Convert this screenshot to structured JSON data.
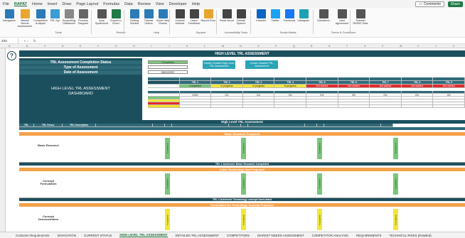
{
  "menu": [
    "File",
    "RAPAT",
    "Home",
    "Insert",
    "Draw",
    "Page Layout",
    "Formulas",
    "Data",
    "Review",
    "View",
    "Developer",
    "Help"
  ],
  "menu_active": "RAPAT",
  "top_buttons": {
    "comments": "Comments",
    "share": "Share"
  },
  "ribbon": {
    "buttons": [
      {
        "label": "Navigation",
        "icon": "navigation-icon",
        "color": "#2b7bb9"
      },
      {
        "label": "Market Needs Assessment",
        "icon": "grid-icon",
        "color": "#e8a530"
      },
      {
        "label": "Competitive Analysis",
        "icon": "people-icon",
        "color": "#2b7bb9"
      },
      {
        "label": "TRL Spi",
        "icon": "chart-icon",
        "color": "#3a9bd5"
      },
      {
        "label": "Supporting Datasheet",
        "icon": "datasheet-icon",
        "color": "#888888"
      },
      {
        "label": "Process Diagram",
        "icon": "diagram-icon",
        "color": "#666666"
      },
      {
        "label": "Auto Spellcheck",
        "icon": "spellcheck-icon",
        "color": "#555555"
      },
      {
        "label": "Export to Excel",
        "icon": "export-icon",
        "color": "#1f7a45"
      },
      {
        "label": "Getting Started",
        "icon": "info-icon",
        "color": "#2b7bb9"
      },
      {
        "label": "Tutorial Videos",
        "icon": "video-icon",
        "color": "#2b7bb9"
      },
      {
        "label": "Excel Help Sheets",
        "icon": "help-icon",
        "color": "#2b7bb9"
      },
      {
        "label": "Contact Antimar",
        "icon": "contact-icon",
        "color": "#444444"
      },
      {
        "label": "Leave Feedback",
        "icon": "feedback-icon",
        "color": "#444444"
      },
      {
        "label": "Report Error",
        "icon": "warning-icon",
        "color": "#e8a530"
      },
      {
        "label": "Read Aloud",
        "icon": "read-aloud-icon",
        "color": "#444444"
      },
      {
        "label": "Dictate Speech",
        "icon": "dictate-icon",
        "color": "#444444"
      },
      {
        "label": "LinkedIn",
        "icon": "linkedin-icon",
        "color": "#0a66c2"
      },
      {
        "label": "Twitter",
        "icon": "twitter-icon",
        "color": "#1da1f2"
      },
      {
        "label": "Facebook",
        "icon": "facebook-icon",
        "color": "#1877f2"
      },
      {
        "label": "Instagram",
        "icon": "instagram-icon",
        "color": "#1ea0b5"
      },
      {
        "label": "Disclaimer",
        "icon": "disclaimer-icon",
        "color": "#555555"
      },
      {
        "label": "User Agreement",
        "icon": "agreement-icon",
        "color": "#555555"
      },
      {
        "label": "Transfer RAPAT Data",
        "icon": "transfer-icon",
        "color": "#555555"
      }
    ],
    "groups": [
      {
        "label": "Tools"
      },
      {
        "label": "Review"
      },
      {
        "label": "Help"
      },
      {
        "label": "Support"
      },
      {
        "label": "Accessibility Tools"
      },
      {
        "label": "Social Media"
      },
      {
        "label": "Terms & Conditions"
      }
    ]
  },
  "formula_bar": {
    "namebox": "Z33",
    "fx": "fx"
  },
  "columns": [
    "A",
    "B",
    "C",
    "D",
    "E",
    "F",
    "G",
    "H",
    "I",
    "J",
    "K",
    "L",
    "M",
    "N",
    "O",
    "P",
    "Q",
    "R",
    "S",
    "T",
    "U",
    "V",
    "W",
    "X",
    "Y",
    "Z"
  ],
  "dashboard": {
    "banner": "HIGH LEVEL TRL ASSESSMENT",
    "rows": [
      "TRL Assessment Completion Status",
      "Type of Assessment",
      "Date of Assessment"
    ],
    "values": [
      "Completed",
      "",
      "08/01/2022"
    ],
    "title_line1": "HIGH LEVEL TRL ASSESSMENT",
    "title_line2": "DASHBOARD",
    "btn1": "Create Detailed High Level TRL Assessment",
    "btn2": "Create Detailed TRL Assessment"
  },
  "summary": {
    "header1": [
      "",
      "",
      "",
      "",
      "",
      "",
      "",
      "",
      "",
      ""
    ],
    "header2": [
      "TRL 1",
      "TRL 2",
      "TRL 3",
      "TRL 4",
      "TRL 5",
      "TRL 6",
      "TRL 7",
      "TRL 8",
      "TRL 9"
    ],
    "status_row": [
      "Completed",
      "In progress",
      "In progress",
      "In progress",
      "Not started",
      "Not started",
      "Not started",
      "Not started",
      "Not started"
    ],
    "pct_row": [
      "100%",
      "0%",
      "0%",
      "0%",
      "0%",
      "0%",
      "0%",
      "0%",
      "0%"
    ],
    "legend": [
      "",
      "",
      "",
      ""
    ]
  },
  "main_table": {
    "title": "High Level TRL Assessment",
    "headers": [
      "TRL",
      "TRL Focus",
      "TRL Description",
      "",
      "",
      "",
      "",
      "",
      "",
      "",
      "",
      "",
      "",
      ""
    ],
    "sub_header": "",
    "sections": [
      {
        "bar": "Basic Research Proposed",
        "trl": "1",
        "name": "Basic Research",
        "desc": "",
        "stat": "Completed"
      },
      {
        "bar": "Initial Technology Idea Proposed",
        "trl": "2",
        "name": "Concept Formulation",
        "desc": "",
        "stat": "Completed"
      },
      {
        "bar": "Formulated the Technology Concept Proposed",
        "trl": "3",
        "name": "Concept Demonstration",
        "desc": "",
        "stat": "In progress"
      }
    ],
    "separators": [
      "TRL 1 Achieved: Basic Research Completed",
      "TRL 2 Achieved: Technology concept formulated"
    ]
  },
  "sheet_tabs": [
    "Customer Requirements",
    "NAVIGATION",
    "CURRENT STATUS",
    "HIGH LEVEL TRL ASSESSMENT",
    "DETAILED TRL ASSESSMENT",
    "COMPETITORS",
    "MARKET NEEDS ASSESSMENT",
    "COMPETITOR ANALYSIS",
    "REQUIREMENTS",
    "TECHNICAL RISKS (Detailed)"
  ],
  "sheet_tab_active": "HIGH LEVEL TRL ASSESSMENT",
  "colors": {
    "teal": "#1b4f5e",
    "teal_light": "#2f6a79",
    "green": "#7bc67b",
    "yellow": "#f1e63d",
    "red": "#e22c2c",
    "orange": "#f4a14b",
    "button": "#2aa3b8"
  }
}
